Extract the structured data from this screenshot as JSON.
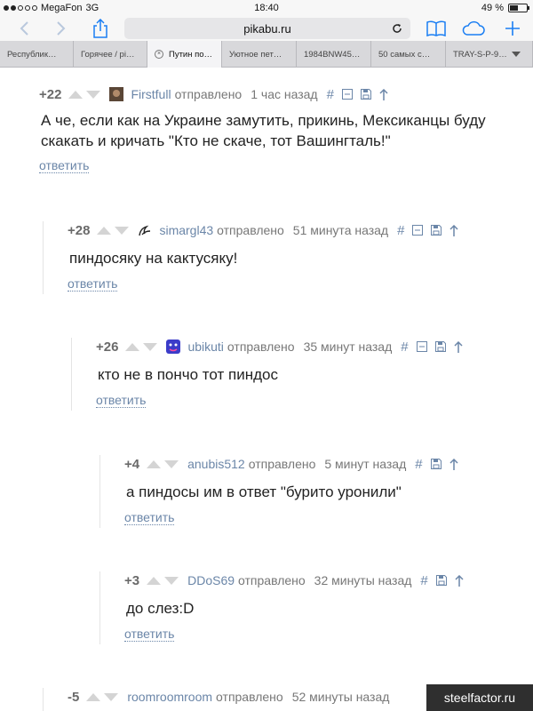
{
  "status_bar": {
    "carrier": "MegaFon",
    "network": "3G",
    "time": "18:40",
    "battery": "49 %",
    "battery_fraction": 0.49
  },
  "browser": {
    "url": "pikabu.ru"
  },
  "tabs": [
    {
      "label": "Республик…",
      "active": false
    },
    {
      "label": "Горячее / pi…",
      "active": false
    },
    {
      "label": "Путин по…",
      "active": true
    },
    {
      "label": "Уютное пет…",
      "active": false
    },
    {
      "label": "1984BNW45…",
      "active": false
    },
    {
      "label": "50 самых с…",
      "active": false
    },
    {
      "label": "TRAY-S-P-9…",
      "active": false
    }
  ],
  "comments": [
    {
      "rating": "+22",
      "user": "Firstfull",
      "sent": "отправлено",
      "time": "1 час назад",
      "text_lines": [
        "А че, если как на Украине замутить, прикинь, Мексиканцы буду",
        "скакать и кричать \"Кто не скаче, тот Вашингталь!\""
      ],
      "reply": "ответить"
    },
    {
      "rating": "+28",
      "user": "simargl43",
      "sent": "отправлено",
      "time": "51 минута назад",
      "text_lines": [
        "пиндосяку на кактусяку!"
      ],
      "reply": "ответить"
    },
    {
      "rating": "+26",
      "user": "ubikuti",
      "sent": "отправлено",
      "time": "35 минут назад",
      "text_lines": [
        "кто не в пончо тот пиндос"
      ],
      "reply": "ответить"
    },
    {
      "rating": "+4",
      "user": "anubis512",
      "sent": "отправлено",
      "time": "5 минут назад",
      "text_lines": [
        "а пиндосы им в ответ \"бурито уронили\""
      ],
      "reply": "ответить"
    },
    {
      "rating": "+3",
      "user": "DDoS69",
      "sent": "отправлено",
      "time": "32 минуты назад",
      "text_lines": [
        "до слез:D"
      ],
      "reply": "ответить"
    },
    {
      "rating": "-5",
      "user": "roomroomroom",
      "sent": "отправлено",
      "time": "52 минуты назад",
      "text_lines": [],
      "reply": ""
    }
  ],
  "watermark": "steelfactor.ru",
  "colors": {
    "link": "#6b86a8",
    "rating": "#6a6a6a",
    "arrow": "#d4d4d4",
    "toolbar": "#f7f7f7",
    "accent": "#1a7ef3"
  }
}
